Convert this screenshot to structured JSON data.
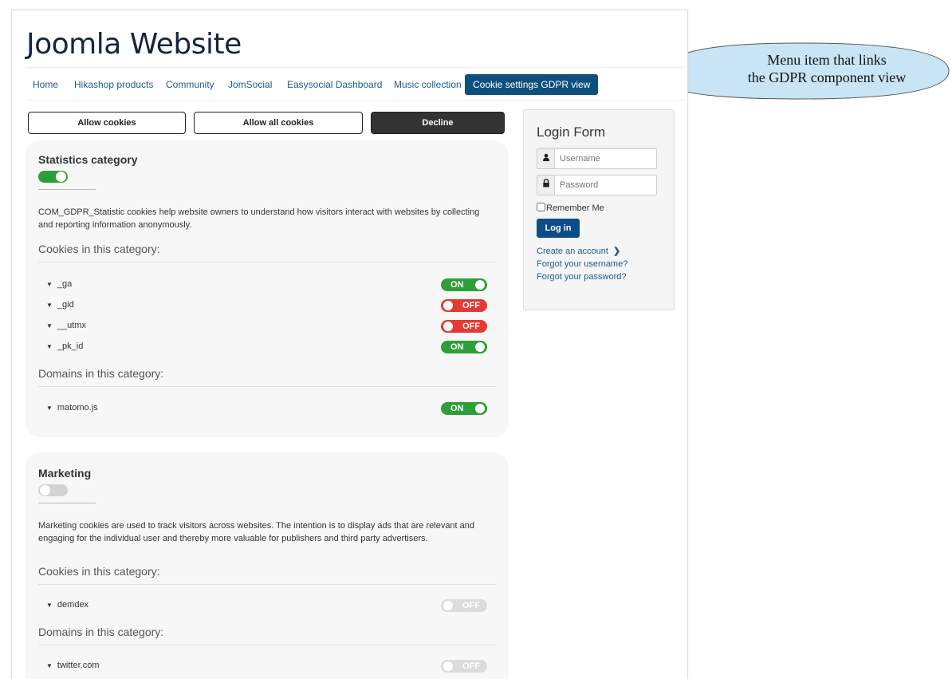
{
  "site": {
    "title": "Joomla Website"
  },
  "nav": {
    "items": [
      {
        "label": "Home"
      },
      {
        "label": "Hikashop products"
      },
      {
        "label": "Community"
      },
      {
        "label": "JomSocial"
      },
      {
        "label": "Easysocial Dashboard"
      },
      {
        "label": "Music collection"
      },
      {
        "label": "Cookie settings GDPR view",
        "active": true
      }
    ]
  },
  "actions": {
    "allow": "Allow cookies",
    "allow_all": "Allow all cookies",
    "decline": "Decline"
  },
  "categories": [
    {
      "title": "Statistics category",
      "enabled": true,
      "description": "COM_GDPR_Statistic cookies help website owners to understand how visitors interact with websites by collecting and reporting information anonymously.",
      "cookies_heading": "Cookies in this category:",
      "cookies": [
        {
          "name": "_ga",
          "state": "ON"
        },
        {
          "name": "_gid",
          "state": "OFF"
        },
        {
          "name": "__utmx",
          "state": "OFF"
        },
        {
          "name": "_pk_id",
          "state": "ON"
        }
      ],
      "domains_heading": "Domains in this category:",
      "domains": [
        {
          "name": "matomo.js",
          "state": "ON"
        }
      ]
    },
    {
      "title": "Marketing",
      "enabled": false,
      "description": "Marketing cookies are used to track visitors across websites. The intention is to display ads that are relevant and engaging for the individual user and thereby more valuable for publishers and third party advertisers.",
      "cookies_heading": "Cookies in this category:",
      "cookies": [
        {
          "name": "demdex",
          "state": "OFF"
        }
      ],
      "domains_heading": "Domains in this category:",
      "domains": [
        {
          "name": "twitter.com",
          "state": "OFF"
        }
      ]
    }
  ],
  "login": {
    "title": "Login Form",
    "username_placeholder": "Username",
    "password_placeholder": "Password",
    "remember_label": "Remember Me",
    "submit_label": "Log in",
    "create_account": "Create an account",
    "forgot_username": "Forgot your username?",
    "forgot_password": "Forgot your password?"
  },
  "callout": {
    "line1": "Menu item that links",
    "line2": "the GDPR component view"
  },
  "icons": {
    "user": "user-icon",
    "lock": "lock-icon",
    "chevron": "chevron-right-icon",
    "caret": "caret-down-icon"
  },
  "colors": {
    "nav_active": "#0f4f7d",
    "toggle_on": "#2e9e38",
    "toggle_off": "#e53935",
    "toggle_disabled": "#dcdcdc",
    "login_button": "#0e4c88",
    "callout_fill": "#c9e4f4"
  }
}
